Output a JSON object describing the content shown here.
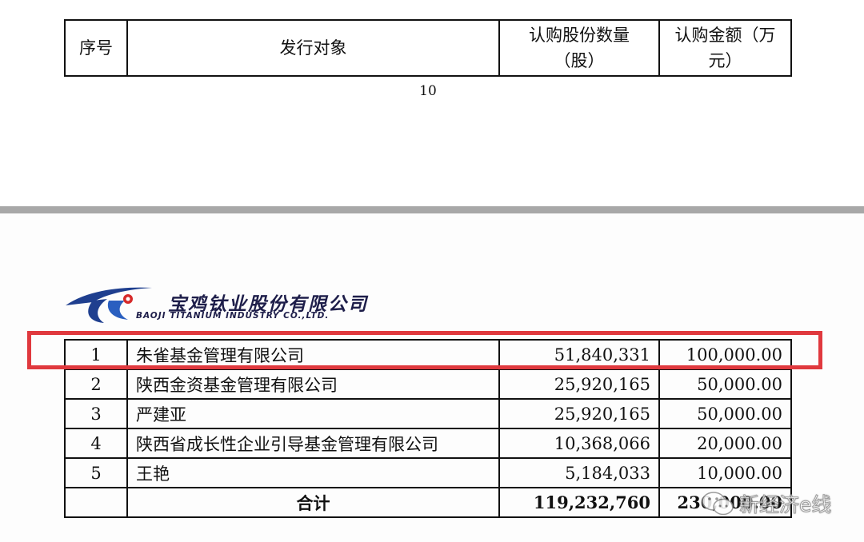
{
  "header_table": {
    "col_no": "序号",
    "col_target": "发行对象",
    "col_shares": "认购股份数量（股）",
    "col_amount": "认购金额（万元）"
  },
  "page_number": "10",
  "logo": {
    "company_cn": "宝鸡钛业股份有限公司",
    "company_en": "BAOJI TITANIUM INDUSTRY CO.,LTD."
  },
  "rows": [
    {
      "no": "1",
      "name": "朱雀基金管理有限公司",
      "shares": "51,840,331",
      "amount": "100,000.00"
    },
    {
      "no": "2",
      "name": "陕西金资基金管理有限公司",
      "shares": "25,920,165",
      "amount": "50,000.00"
    },
    {
      "no": "3",
      "name": "严建亚",
      "shares": "25,920,165",
      "amount": "50,000.00"
    },
    {
      "no": "4",
      "name": "陕西省成长性企业引导基金管理有限公司",
      "shares": "10,368,066",
      "amount": "20,000.00"
    },
    {
      "no": "5",
      "name": "王艳",
      "shares": "5,184,033",
      "amount": "10,000.00"
    }
  ],
  "total": {
    "label": "合计",
    "shares": "119,232,760",
    "amount": "230,000.00"
  },
  "highlight_color": "#e0393e",
  "watermark": {
    "icon": "wechat-icon",
    "text": "新经济e线"
  }
}
